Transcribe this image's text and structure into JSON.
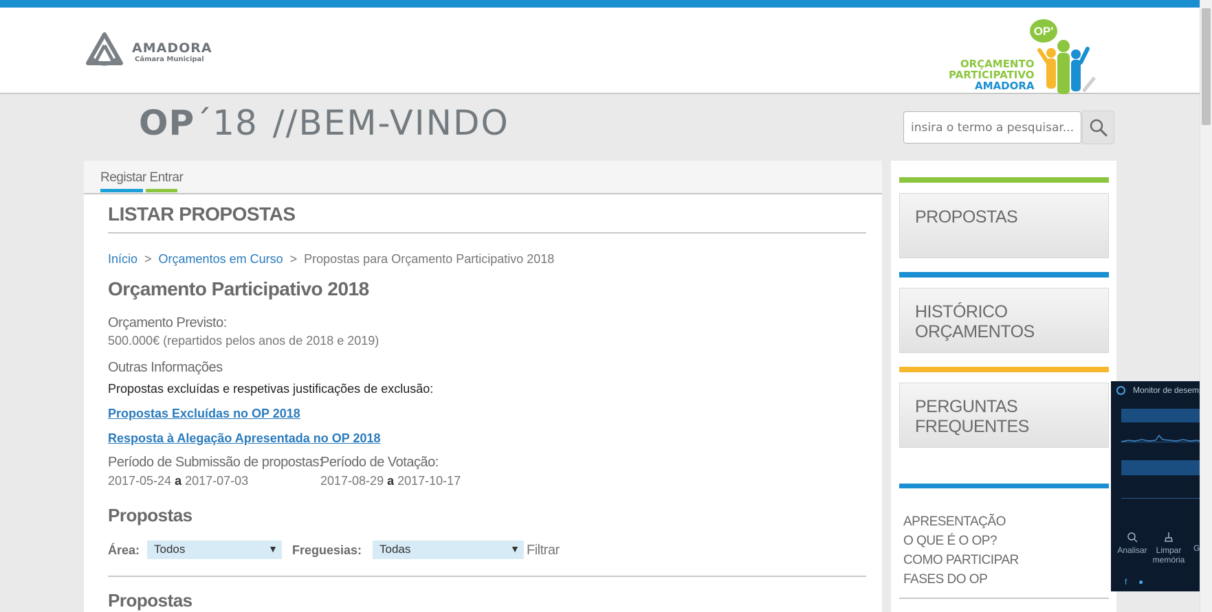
{
  "header": {
    "city_name": "AMADORA",
    "city_sub": "Câmara Municipal",
    "op_logo": {
      "line1": "ORÇAMENTO",
      "line2": "PARTICIPATIVO",
      "line3": "AMADORA",
      "badge": "OP'"
    }
  },
  "title": {
    "op": "OP",
    "year": "´18",
    "welcome": "//BEM-VINDO"
  },
  "search": {
    "placeholder": "insira o termo a pesquisar..."
  },
  "userbar": {
    "register": "Registar",
    "login": "Entrar"
  },
  "main": {
    "section_title": "LISTAR PROPOSTAS",
    "breadcrumb": {
      "home": "Início",
      "current_budgets": "Orçamentos em Curso",
      "current": "Propostas para Orçamento Participativo 2018",
      "separator": ">"
    },
    "budget_title": "Orçamento Participativo 2018",
    "forecast_label": "Orçamento Previsto:",
    "forecast_value": "500.000€ (repartidos pelos anos de 2018 e 2019)",
    "other_info_label": "Outras Informações",
    "other_info_text": "Propostas excluídas e respetivas justificações de exclusão:",
    "link_excluded": "Propostas Excluídas no OP 2018",
    "link_response": "Resposta à Alegação Apresentada no OP 2018",
    "submission_label": "Período de Submissão de propostas:",
    "submission_start": "2017-05-24",
    "submission_end": "2017-07-03",
    "voting_label": "Período de Votação:",
    "voting_start": "2017-08-29",
    "voting_end": "2017-10-17",
    "range_word": "a",
    "proposals_heading": "Propostas",
    "filters": {
      "area_label": "Área:",
      "area_value": "Todos",
      "parish_label": "Freguesias:",
      "parish_value": "Todas",
      "filter_button": "Filtrar"
    },
    "proposals_heading2": "Propostas"
  },
  "sidebar": {
    "boxes": [
      "PROPOSTAS",
      "HISTÓRICO ORÇAMENTOS",
      "PERGUNTAS FREQUENTES"
    ],
    "links": [
      "APRESENTAÇÃO",
      "O QUE É O OP?",
      "COMO PARTICIPAR",
      "FASES DO OP"
    ],
    "colors": {
      "green": "#8cc63f",
      "blue": "#1a8fd1",
      "yellow": "#f7b82e"
    }
  },
  "performance_monitor": {
    "title": "Monitor de desempenho",
    "actions": [
      "Analisar",
      "Limpar memória",
      "Ge R"
    ]
  },
  "colors": {
    "topbar": "#1a8fd1",
    "link": "#2a7bbd",
    "accent_blue": "#1aa0d8",
    "accent_green": "#8cc63f"
  }
}
